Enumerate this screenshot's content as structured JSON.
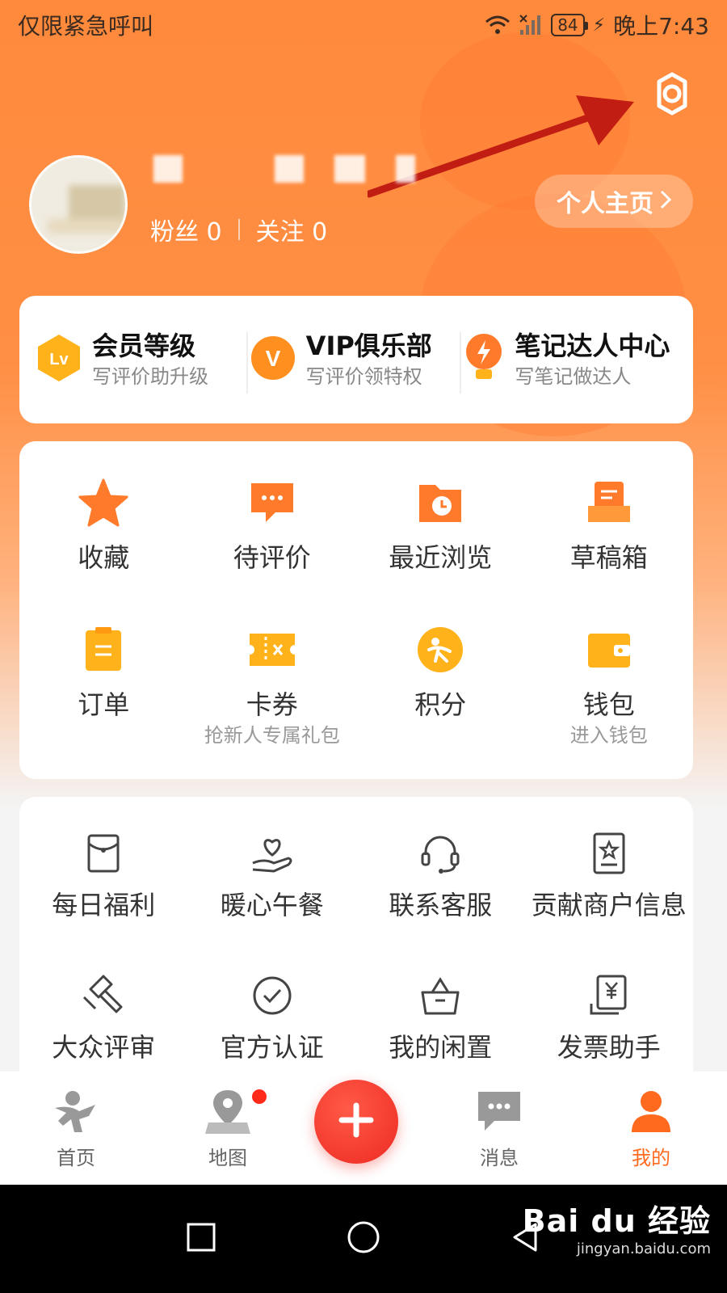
{
  "status_bar": {
    "carrier": "仅限紧急呼叫",
    "battery": "84",
    "time": "晚上7:43"
  },
  "profile": {
    "fans_label": "粉丝 0",
    "follow_label": "关注 0",
    "homepage_button": "个人主页"
  },
  "vip_row": [
    {
      "title": "会员等级",
      "subtitle": "写评价助升级",
      "icon": "lv-badge-icon"
    },
    {
      "title": "VIP俱乐部",
      "subtitle": "写评价领特权",
      "icon": "vip-badge-icon"
    },
    {
      "title": "笔记达人中心",
      "subtitle": "写笔记做达人",
      "icon": "bulb-bolt-icon"
    }
  ],
  "main_grid": [
    {
      "label": "收藏",
      "sub": "",
      "icon": "star-icon"
    },
    {
      "label": "待评价",
      "sub": "",
      "icon": "comment-icon"
    },
    {
      "label": "最近浏览",
      "sub": "",
      "icon": "clock-folder-icon"
    },
    {
      "label": "草稿箱",
      "sub": "",
      "icon": "draft-box-icon"
    },
    {
      "label": "订单",
      "sub": "",
      "icon": "order-icon"
    },
    {
      "label": "卡券",
      "sub": "抢新人专属礼包",
      "icon": "ticket-icon"
    },
    {
      "label": "积分",
      "sub": "",
      "icon": "points-icon"
    },
    {
      "label": "钱包",
      "sub": "进入钱包",
      "icon": "wallet-icon"
    }
  ],
  "service_grid": [
    {
      "label": "每日福利",
      "icon": "red-envelope-icon"
    },
    {
      "label": "暖心午餐",
      "icon": "heart-hand-icon"
    },
    {
      "label": "联系客服",
      "icon": "headset-icon"
    },
    {
      "label": "贡献商户信息",
      "icon": "merchant-info-icon"
    },
    {
      "label": "大众评审",
      "icon": "gavel-icon"
    },
    {
      "label": "官方认证",
      "icon": "check-circle-icon"
    },
    {
      "label": "我的闲置",
      "icon": "bag-icon"
    },
    {
      "label": "发票助手",
      "icon": "invoice-icon"
    }
  ],
  "tabs": [
    {
      "label": "首页",
      "icon": "home-mascot-icon"
    },
    {
      "label": "地图",
      "icon": "map-pin-icon"
    },
    {
      "label": "消息",
      "icon": "message-icon"
    },
    {
      "label": "我的",
      "icon": "person-icon"
    }
  ],
  "watermark": {
    "logo": "Bai du 经验",
    "url": "jingyan.baidu.com"
  },
  "colors": {
    "accent": "#ff6a1f",
    "post_button": "#ee2a22",
    "icon_orange": "#ff7a2a",
    "icon_yellow": "#ffb21a"
  }
}
